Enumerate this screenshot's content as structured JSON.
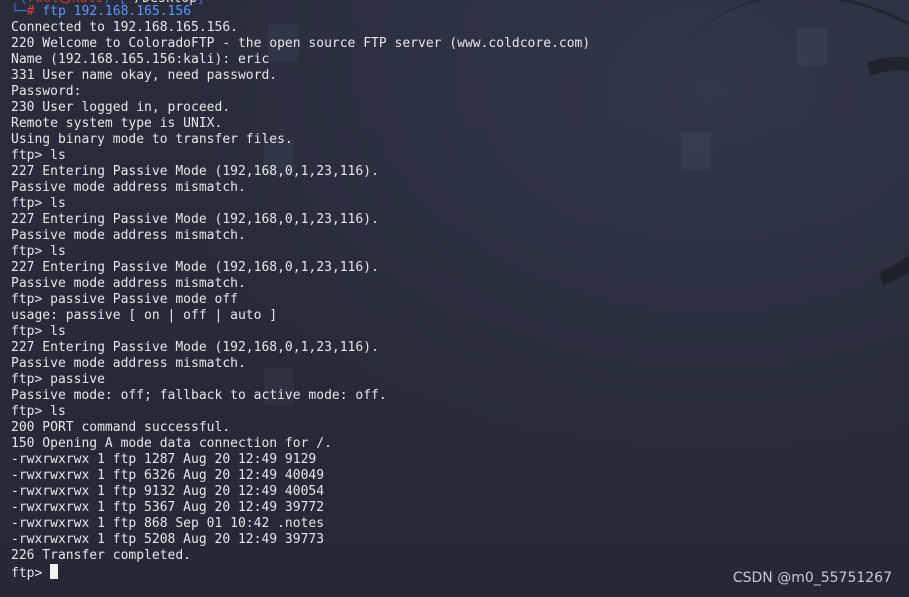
{
  "terminal": {
    "prompt_top_text": "└─# ",
    "command": "ftp 192.168.165.156",
    "lines": [
      "Connected to 192.168.165.156.",
      "220 Welcome to ColoradoFTP - the open source FTP server (www.coldcore.com)",
      "Name (192.168.165.156:kali): eric",
      "331 User name okay, need password.",
      "Password:",
      "230 User logged in, proceed.",
      "Remote system type is UNIX.",
      "Using binary mode to transfer files.",
      "ftp> ls",
      "227 Entering Passive Mode (192,168,0,1,23,116).",
      "Passive mode address mismatch.",
      "ftp> ls",
      "227 Entering Passive Mode (192,168,0,1,23,116).",
      "Passive mode address mismatch.",
      "ftp> ls",
      "227 Entering Passive Mode (192,168,0,1,23,116).",
      "Passive mode address mismatch.",
      "ftp> passive Passive mode off",
      "usage: passive [ on | off | auto ]",
      "ftp> ls",
      "227 Entering Passive Mode (192,168,0,1,23,116).",
      "Passive mode address mismatch.",
      "ftp> passive",
      "Passive mode: off; fallback to active mode: off.",
      "ftp> ls",
      "200 PORT command successful.",
      "150 Opening A mode data connection for /.",
      "-rwxrwxrwx 1 ftp 1287 Aug 20 12:49 9129",
      "-rwxrwxrwx 1 ftp 6326 Aug 20 12:49 40049",
      "-rwxrwxrwx 1 ftp 9132 Aug 20 12:49 40054",
      "-rwxrwxrwx 1 ftp 5367 Aug 20 12:49 39772",
      "-rwxrwxrwx 1 ftp 868 Sep 01 10:42 .notes",
      "-rwxrwxrwx 1 ftp 5208 Aug 20 12:49 39773",
      "226 Transfer completed."
    ],
    "current_prompt": "ftp> "
  },
  "watermark": "CSDN @m0_55751267",
  "colors": {
    "background": "#262a38",
    "text": "#e6e6ea",
    "prompt_decor": "#3f73d8",
    "root_hash": "#e23c3c",
    "command": "#5f95ff"
  }
}
